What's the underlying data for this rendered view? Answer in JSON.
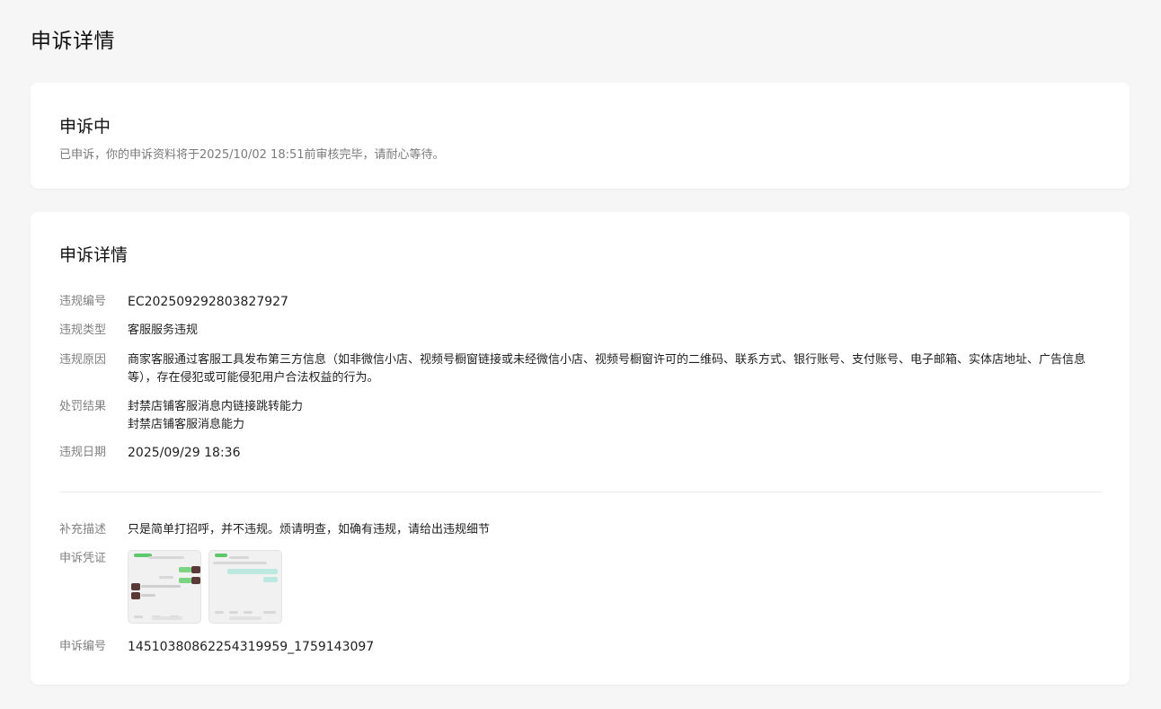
{
  "page": {
    "title": "申诉详情"
  },
  "status": {
    "title": "申诉中",
    "description": "已申诉，你的申诉资料将于2025/10/02 18:51前审核完毕，请耐心等待。"
  },
  "detail": {
    "title": "申诉详情",
    "violation_id": {
      "label": "违规编号",
      "value": "EC202509292803827927"
    },
    "violation_type": {
      "label": "违规类型",
      "value": "客服服务违规"
    },
    "violation_reason": {
      "label": "违规原因",
      "value": "商家客服通过客服工具发布第三方信息（如非微信小店、视频号橱窗链接或未经微信小店、视频号橱窗许可的二维码、联系方式、银行账号、支付账号、电子邮箱、实体店地址、广告信息等），存在侵犯或可能侵犯用户合法权益的行为。"
    },
    "penalty": {
      "label": "处罚结果",
      "line1": "封禁店铺客服消息内链接跳转能力",
      "line2": "封禁店铺客服消息能力"
    },
    "violation_date": {
      "label": "违规日期",
      "value": "2025/09/29 18:36"
    },
    "supplement": {
      "label": "补充描述",
      "value": "只是简单打招呼，并不违规。烦请明查，如确有违规，请给出违规细节"
    },
    "evidence": {
      "label": "申诉凭证"
    },
    "appeal_id": {
      "label": "申诉编号",
      "value": "14510380862254319959_1759143097"
    }
  }
}
